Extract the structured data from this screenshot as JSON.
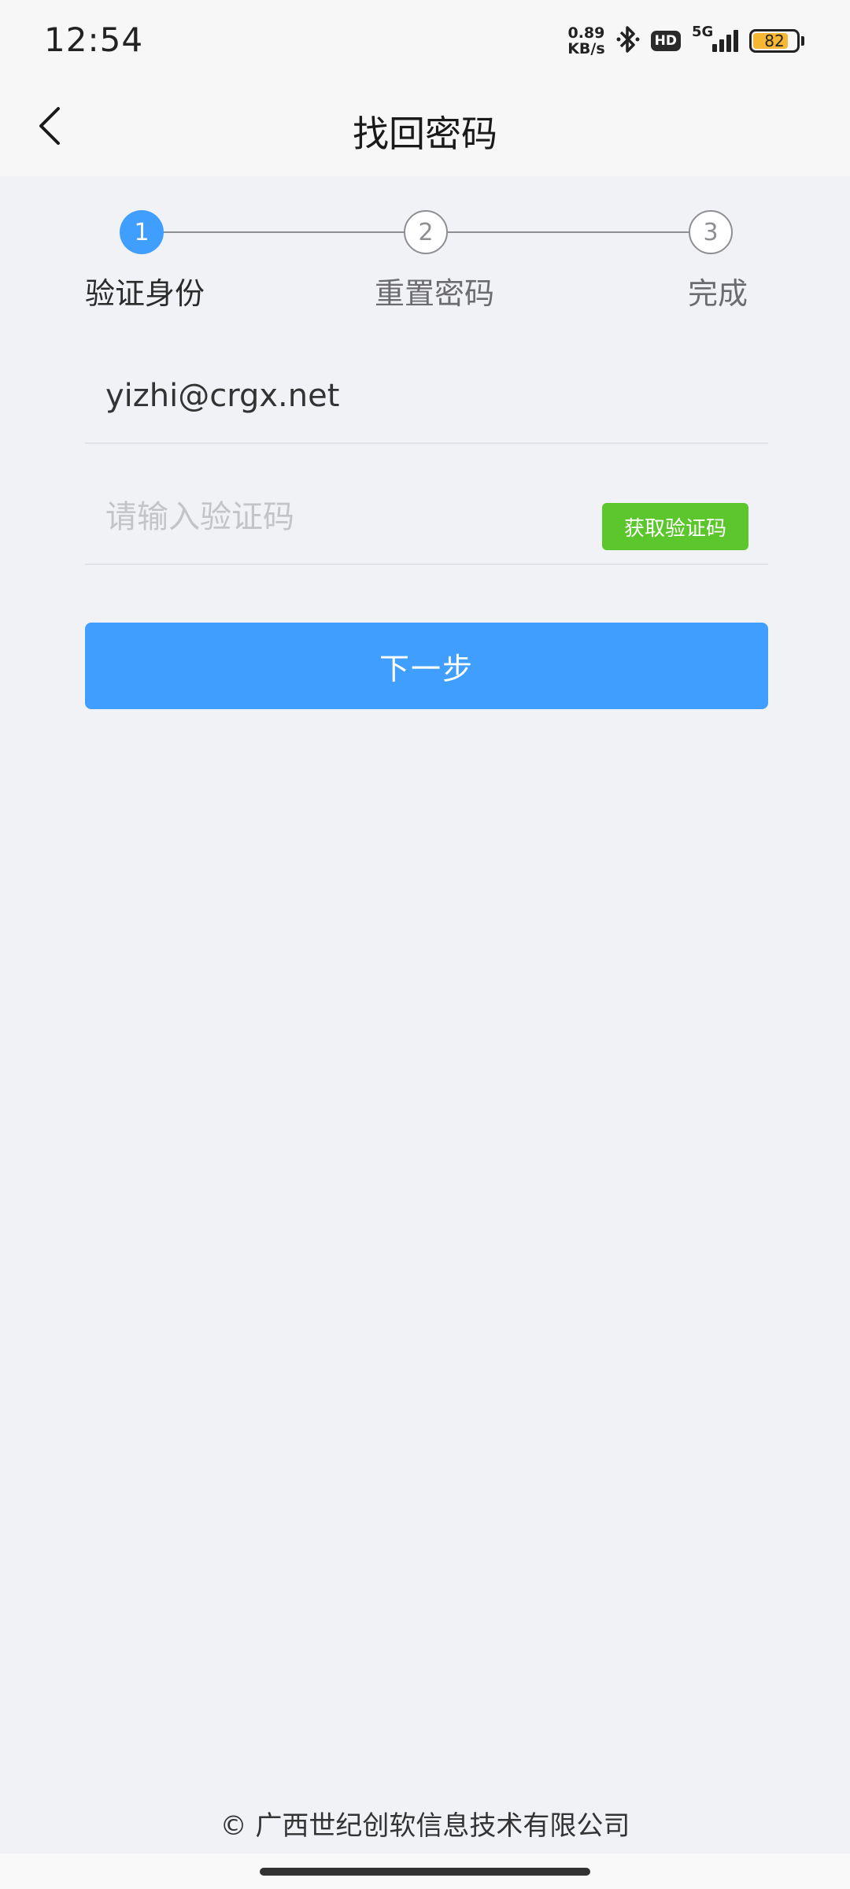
{
  "status_bar": {
    "time": "12:54",
    "net_speed_value": "0.89",
    "net_speed_unit": "KB/s",
    "hd": "HD",
    "network": "5G",
    "battery": "82",
    "battery_level": 0.82,
    "battery_color": "#f7b733"
  },
  "nav": {
    "title": "找回密码",
    "back_icon": "chevron-left-icon"
  },
  "steps": [
    {
      "number": "1",
      "label": "验证身份",
      "state": "active"
    },
    {
      "number": "2",
      "label": "重置密码",
      "state": "inactive"
    },
    {
      "number": "3",
      "label": "完成",
      "state": "inactive"
    }
  ],
  "form": {
    "email_value": "yizhi@crgx.net",
    "code_placeholder": "请输入验证码",
    "get_code_label": "获取验证码",
    "next_label": "下一步"
  },
  "footer": {
    "copyright": "© 广西世纪创软信息技术有限公司"
  },
  "colors": {
    "primary": "#409eff",
    "success": "#5cc62d",
    "background": "#f1f2f6"
  }
}
